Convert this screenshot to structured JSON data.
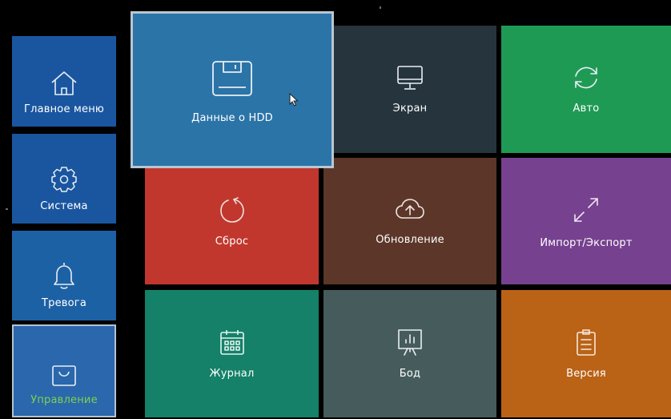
{
  "sidebar": {
    "items": [
      {
        "label": "Главное меню",
        "icon": "home-icon"
      },
      {
        "label": "Система",
        "icon": "gear-icon"
      },
      {
        "label": "Тревога",
        "icon": "bell-icon"
      },
      {
        "label": "Управление",
        "icon": "bag-icon",
        "selected": true
      }
    ]
  },
  "tiles": [
    {
      "label": "Данные о HDD",
      "icon": "floppy-disk-icon",
      "color": "#2b74a8",
      "focused": true
    },
    {
      "label": "Экран",
      "icon": "monitor-icon",
      "color": "#26343d"
    },
    {
      "label": "Авто",
      "icon": "refresh-icon",
      "color": "#1f9a54"
    },
    {
      "label": "Сброс",
      "icon": "reset-icon",
      "color": "#c1372e"
    },
    {
      "label": "Обновление",
      "icon": "cloud-upload-icon",
      "color": "#5c3629"
    },
    {
      "label": "Импорт/Экспорт",
      "icon": "expand-arrows-icon",
      "color": "#76418e"
    },
    {
      "label": "Журнал",
      "icon": "calendar-icon",
      "color": "#148168"
    },
    {
      "label": "Бод",
      "icon": "presentation-board-icon",
      "color": "#465c5c"
    },
    {
      "label": "Версия",
      "icon": "clipboard-icon",
      "color": "#ba6216"
    }
  ],
  "colors": {
    "selected_label": "#7bd34c",
    "focus_border": "#b9c6cf"
  }
}
